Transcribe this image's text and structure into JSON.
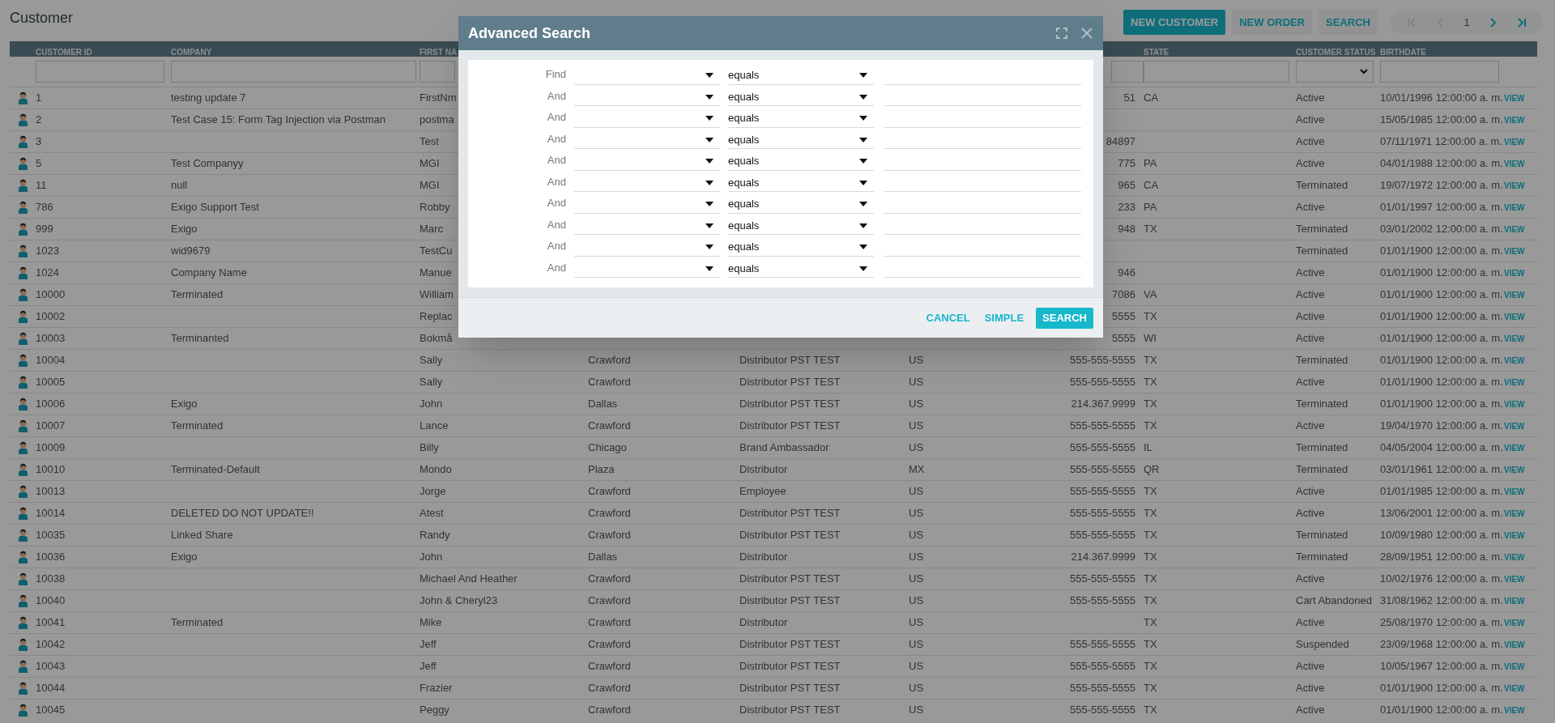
{
  "page": {
    "title": "Customer"
  },
  "toolbar": {
    "buttons": [
      {
        "label": "NEW CUSTOMER",
        "kind": "primary"
      },
      {
        "label": "NEW ORDER",
        "kind": "secondary"
      },
      {
        "label": "SEARCH",
        "kind": "secondary"
      }
    ]
  },
  "pagination": {
    "first": {
      "disabled": true
    },
    "previous": {
      "disabled": true
    },
    "page": "1",
    "next": {
      "disabled": false
    },
    "last": {
      "disabled": false
    }
  },
  "table": {
    "headings": {
      "customer_id": "CUSTOMER ID",
      "company": "COMPANY",
      "column_3": "FIRST NA",
      "state": "STATE",
      "customer_status": "CUSTOMER STATUS",
      "birthdate": "BIRTHDATE"
    },
    "rows": [
      {
        "customer_id": "1",
        "company": "testing update 7",
        "column_3": "FirstNm",
        "column_7": "51",
        "state": "CA",
        "customer_status": "Active",
        "birthdate": "10/01/1996 12:00:00 a. m.",
        "column_11": "VIEW"
      },
      {
        "customer_id": "2",
        "company": "Test Case 15: Form Tag Injection via Postman",
        "column_3": "postma",
        "customer_status": "Active",
        "birthdate": "15/05/1985 12:00:00 a. m.",
        "column_11": "VIEW"
      },
      {
        "customer_id": "3",
        "column_3": "Test",
        "column_7": "84897",
        "customer_status": "Active",
        "birthdate": "07/11/1971 12:00:00 a. m.",
        "column_11": "VIEW"
      },
      {
        "customer_id": "5",
        "company": "Test Companyy",
        "column_3": "MGI",
        "column_7": "775",
        "state": "PA",
        "customer_status": "Active",
        "birthdate": "04/01/1988 12:00:00 a. m.",
        "column_11": "VIEW"
      },
      {
        "customer_id": "11",
        "company": "null",
        "column_3": "MGI",
        "column_7": "965",
        "state": "CA",
        "customer_status": "Terminated",
        "birthdate": "19/07/1972 12:00:00 a. m.",
        "column_11": "VIEW"
      },
      {
        "customer_id": "786",
        "company": "Exigo Support Test",
        "column_3": "Robby",
        "column_7": "233",
        "state": "PA",
        "customer_status": "Active",
        "birthdate": "01/01/1997 12:00:00 a. m.",
        "column_11": "VIEW"
      },
      {
        "customer_id": "999",
        "company": "Exigo",
        "column_3": "Marc",
        "column_7": "948",
        "state": "TX",
        "customer_status": "Terminated",
        "birthdate": "03/01/2002 12:00:00 a. m.",
        "column_11": "VIEW"
      },
      {
        "customer_id": "1023",
        "company": "wid9679",
        "column_3": "TestCu",
        "customer_status": "Terminated",
        "birthdate": "01/01/1900 12:00:00 a. m.",
        "column_11": "VIEW"
      },
      {
        "customer_id": "1024",
        "company": "Company Name",
        "column_3": "Manue",
        "column_7": "946",
        "customer_status": "Active",
        "birthdate": "01/01/1900 12:00:00 a. m.",
        "column_11": "VIEW"
      },
      {
        "customer_id": "10000",
        "company": "Terminated",
        "column_3": "William",
        "column_7": "7086",
        "state": "VA",
        "customer_status": "Active",
        "birthdate": "01/01/1900 12:00:00 a. m.",
        "column_11": "VIEW"
      },
      {
        "customer_id": "10002",
        "column_3": "Replac",
        "column_7": "5555",
        "state": "TX",
        "customer_status": "Active",
        "birthdate": "01/01/1900 12:00:00 a. m.",
        "column_11": "VIEW"
      },
      {
        "customer_id": "10003",
        "company": "Terminanted",
        "column_3": "Bokmå",
        "column_7": "5555",
        "state": "WI",
        "customer_status": "Active",
        "birthdate": "01/01/1900 12:00:00 a. m.",
        "column_11": "VIEW"
      },
      {
        "customer_id": "10004",
        "column_3": "Sally",
        "column_4": "Crawford",
        "column_5": "Distributor PST TEST",
        "column_6": "US",
        "column_7": "555-555-5555",
        "state": "TX",
        "customer_status": "Terminated",
        "birthdate": "01/01/1900 12:00:00 a. m.",
        "column_11": "VIEW"
      },
      {
        "customer_id": "10005",
        "column_3": "Sally",
        "column_4": "Crawford",
        "column_5": "Distributor PST TEST",
        "column_6": "US",
        "column_7": "555-555-5555",
        "state": "TX",
        "customer_status": "Active",
        "birthdate": "01/01/1900 12:00:00 a. m.",
        "column_11": "VIEW"
      },
      {
        "customer_id": "10006",
        "company": "Exigo",
        "column_3": "John",
        "column_4": "Dallas",
        "column_5": "Distributor PST TEST",
        "column_6": "US",
        "column_7": "214.367.9999",
        "state": "TX",
        "customer_status": "Terminated",
        "birthdate": "01/01/1900 12:00:00 a. m.",
        "column_11": "VIEW"
      },
      {
        "customer_id": "10007",
        "company": "Terminated",
        "column_3": "Lance",
        "column_4": "Crawford",
        "column_5": "Distributor PST TEST",
        "column_6": "US",
        "column_7": "555-555-5555",
        "state": "TX",
        "customer_status": "Active",
        "birthdate": "19/04/1970 12:00:00 a. m.",
        "column_11": "VIEW"
      },
      {
        "customer_id": "10009",
        "column_3": "Billy",
        "column_4": "Chicago",
        "column_5": "Brand Ambassador",
        "column_6": "US",
        "column_7": "555-555-5555",
        "state": "IL",
        "customer_status": "Terminated",
        "birthdate": "04/05/2004 12:00:00 a. m.",
        "column_11": "VIEW"
      },
      {
        "customer_id": "10010",
        "company": "Terminated-Default",
        "column_3": "Mondo",
        "column_4": "Plaza",
        "column_5": "Distributor",
        "column_6": "MX",
        "column_7": "555-555-5555",
        "state": "QR",
        "customer_status": "Terminated",
        "birthdate": "03/01/1961 12:00:00 a. m.",
        "column_11": "VIEW"
      },
      {
        "customer_id": "10013",
        "column_3": "Jorge",
        "column_4": "Crawford",
        "column_5": "Employee",
        "column_6": "US",
        "column_7": "555-555-5555",
        "state": "TX",
        "customer_status": "Active",
        "birthdate": "01/01/1985 12:00:00 a. m.",
        "column_11": "VIEW"
      },
      {
        "customer_id": "10014",
        "company": "DELETED DO NOT UPDATE!!",
        "column_3": "Atest",
        "column_4": "Crawford",
        "column_5": "Distributor PST TEST",
        "column_6": "US",
        "column_7": "555-555-5555",
        "state": "TX",
        "customer_status": "Active",
        "birthdate": "13/06/2001 12:00:00 a. m.",
        "column_11": "VIEW"
      },
      {
        "customer_id": "10035",
        "company": "Linked Share",
        "column_3": "Randy",
        "column_4": "Crawford",
        "column_5": "Distributor PST TEST",
        "column_6": "US",
        "column_7": "555-555-5555",
        "state": "TX",
        "customer_status": "Terminated",
        "birthdate": "10/09/1980 12:00:00 a. m.",
        "column_11": "VIEW"
      },
      {
        "customer_id": "10036",
        "company": "Exigo",
        "column_3": "John",
        "column_4": "Dallas",
        "column_5": "Distributor",
        "column_6": "US",
        "column_7": "214.367.9999",
        "state": "TX",
        "customer_status": "Terminated",
        "birthdate": "28/09/1951 12:00:00 a. m.",
        "column_11": "VIEW"
      },
      {
        "customer_id": "10038",
        "column_3": "Michael And Heather",
        "column_4": "Crawford",
        "column_5": "Distributor PST TEST",
        "column_6": "US",
        "column_7": "555-555-5555",
        "state": "TX",
        "customer_status": "Active",
        "birthdate": "10/02/1976 12:00:00 a. m.",
        "column_11": "VIEW"
      },
      {
        "customer_id": "10040",
        "column_3": "John & Cheryl23",
        "column_4": "Crawford",
        "column_5": "Distributor PST TEST",
        "column_6": "US",
        "column_7": "555-555-5555",
        "state": "TX",
        "customer_status": "Cart Abandoned",
        "birthdate": "31/08/1962 12:00:00 a. m.",
        "column_11": "VIEW"
      },
      {
        "customer_id": "10041",
        "company": "Terminated",
        "column_3": "Mike",
        "column_4": "Crawford",
        "column_5": "Distributor",
        "column_6": "US",
        "state": "TX",
        "customer_status": "Active",
        "birthdate": "25/08/1970 12:00:00 a. m.",
        "column_11": "VIEW"
      },
      {
        "customer_id": "10042",
        "column_3": "Jeff",
        "column_4": "Crawford",
        "column_5": "Distributor PST TEST",
        "column_6": "US",
        "column_7": "555-555-5555",
        "state": "TX",
        "customer_status": "Suspended",
        "birthdate": "23/09/1968 12:00:00 a. m.",
        "column_11": "VIEW"
      },
      {
        "customer_id": "10043",
        "column_3": "Jeff",
        "column_4": "Crawford",
        "column_5": "Distributor PST TEST",
        "column_6": "US",
        "column_7": "555-555-5555",
        "state": "TX",
        "customer_status": "Active",
        "birthdate": "10/05/1967 12:00:00 a. m.",
        "column_11": "VIEW"
      },
      {
        "customer_id": "10044",
        "column_3": "Frazier",
        "column_4": "Crawford",
        "column_5": "Distributor PST TEST",
        "column_6": "US",
        "column_7": "555-555-5555",
        "state": "TX",
        "customer_status": "Active",
        "birthdate": "01/01/1900 12:00:00 a. m.",
        "column_11": "VIEW"
      },
      {
        "customer_id": "10045",
        "column_3": "Peggy",
        "column_4": "Crawford",
        "column_5": "Distributor PST TEST",
        "column_6": "US",
        "column_7": "555-555-5555",
        "state": "TX",
        "customer_status": "Active",
        "birthdate": "01/01/1900 12:00:00 a. m.",
        "column_11": "VIEW"
      }
    ]
  },
  "dialog": {
    "title": "Advanced Search",
    "criteria": [
      {
        "conjunction": "Find",
        "operator": "equals"
      },
      {
        "conjunction": "And",
        "operator": "equals"
      },
      {
        "conjunction": "And",
        "operator": "equals"
      },
      {
        "conjunction": "And",
        "operator": "equals"
      },
      {
        "conjunction": "And",
        "operator": "equals"
      },
      {
        "conjunction": "And",
        "operator": "equals"
      },
      {
        "conjunction": "And",
        "operator": "equals"
      },
      {
        "conjunction": "And",
        "operator": "equals"
      },
      {
        "conjunction": "And",
        "operator": "equals"
      },
      {
        "conjunction": "And",
        "operator": "equals"
      }
    ],
    "buttons": [
      {
        "label": "CANCEL",
        "kind": "text"
      },
      {
        "label": "SIMPLE",
        "kind": "text"
      },
      {
        "label": "SEARCH",
        "kind": "primary"
      }
    ]
  }
}
